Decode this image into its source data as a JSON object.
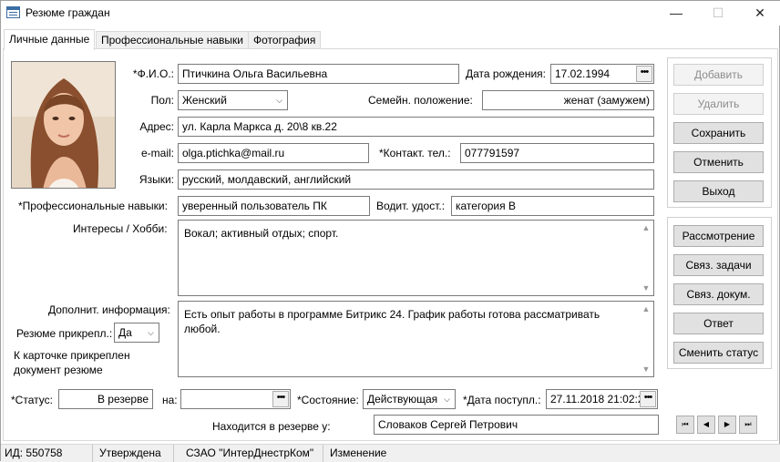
{
  "window": {
    "title": "Резюме граждан",
    "minimize": "—",
    "maximize": "☐",
    "close": "✕"
  },
  "tabs": [
    "Личные данные",
    "Профессиональные навыки",
    "Фотография"
  ],
  "personal": {
    "fio_label": "*Ф.И.О.:",
    "fio": "Птичкина Ольга Васильевна",
    "birth_label": "Дата рождения:",
    "birth": "17.02.1994",
    "gender_label": "Пол:",
    "gender": "Женский",
    "marital_label": "Семейн. положение:",
    "marital": "женат (замужем)",
    "address_label": "Адрес:",
    "address": "ул. Карла Маркса д. 20\\8 кв.22",
    "email_label": "e-mail:",
    "email": "olga.ptichka@mail.ru",
    "phone_label": "*Контакт. тел.:",
    "phone": "077791597",
    "languages_label": "Языки:",
    "languages": "русский, молдавский, английский",
    "skills_label": "*Профессиональные навыки:",
    "skills": "уверенный пользователь ПК",
    "license_label": "Водит. удост.:",
    "license": "категория B",
    "hobby_label": "Интересы / Хобби:",
    "hobby": "Вокал; активный отдых; спорт.",
    "extra_label": "Дополнит. информация:",
    "extra": "Есть опыт работы в программе Битрикс 24. График работы готова рассматривать любой.",
    "attached_label": "Резюме прикрепл.:",
    "attached": "Да",
    "attached_note": "К карточке прикреплен документ резюме"
  },
  "status_row": {
    "status_label": "*Статус:",
    "status": "В резерве",
    "until_label": "на:",
    "until": "",
    "state_label": "*Состояние:",
    "state": "Действующая",
    "date_label": "*Дата поступл.:",
    "date": "27.11.2018 21:02:22",
    "reserve_label": "Находится в резерве у:",
    "reserve_holder": "Словаков Сергей Петрович"
  },
  "buttons": {
    "add": "Добавить",
    "delete": "Удалить",
    "save": "Сохранить",
    "cancel": "Отменить",
    "exit": "Выход",
    "review": "Рассмотрение",
    "tasks": "Связ. задачи",
    "docs": "Связ. докум.",
    "answer": "Ответ",
    "change_status": "Сменить статус"
  },
  "nav": {
    "first": "⏮",
    "prev": "◀",
    "next": "▶",
    "last": "⏭"
  },
  "statusbar": {
    "id": "ИД: 550758",
    "state": "Утверждена",
    "org": "СЗАО \"ИнтерДнестрКом\"",
    "mode": "Изменение"
  },
  "icons": {
    "dots": "•••",
    "combo": "⌵",
    "up": "▲",
    "down": "▼"
  }
}
